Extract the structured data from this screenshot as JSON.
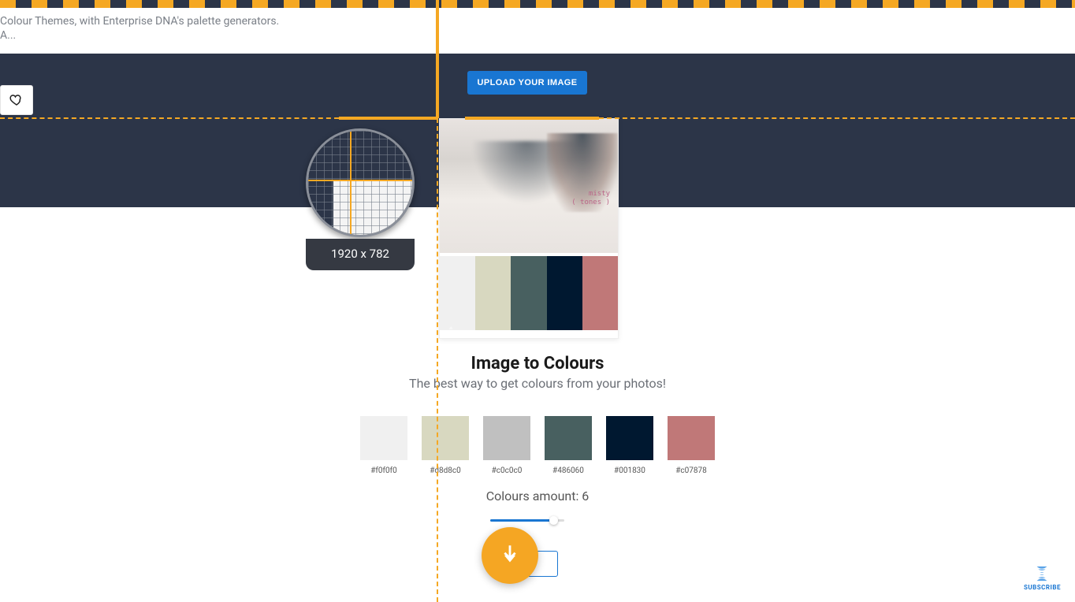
{
  "header": {
    "line1": "Colour Themes, with Enterprise DNA's palette generators.",
    "line2": "A..."
  },
  "upload_button": "UPLOAD YOUR IMAGE",
  "magnifier": {
    "dimensions": "1920 x 782"
  },
  "preview": {
    "overlay_text_1": "misty",
    "overlay_text_2": "( tones )",
    "palette": [
      "#f0f0f0",
      "#d8d8c0",
      "#486060",
      "#001830",
      "#c07878"
    ]
  },
  "section": {
    "title": "Image to Colours",
    "subtitle": "The best way to get colours from your photos!"
  },
  "swatches": [
    {
      "hex": "#f0f0f0",
      "color": "#f0f0f0"
    },
    {
      "hex": "#d8d8c0",
      "color": "#d8d8c0"
    },
    {
      "hex": "#c0c0c0",
      "color": "#c0c0c0"
    },
    {
      "hex": "#486060",
      "color": "#486060"
    },
    {
      "hex": "#001830",
      "color": "#001830"
    },
    {
      "hex": "#c07878",
      "color": "#c07878"
    }
  ],
  "amount": {
    "label": "Colours amount: 6",
    "value": 6,
    "min": 1,
    "max": 7
  },
  "subscribe_label": "SUBSCRIBE"
}
